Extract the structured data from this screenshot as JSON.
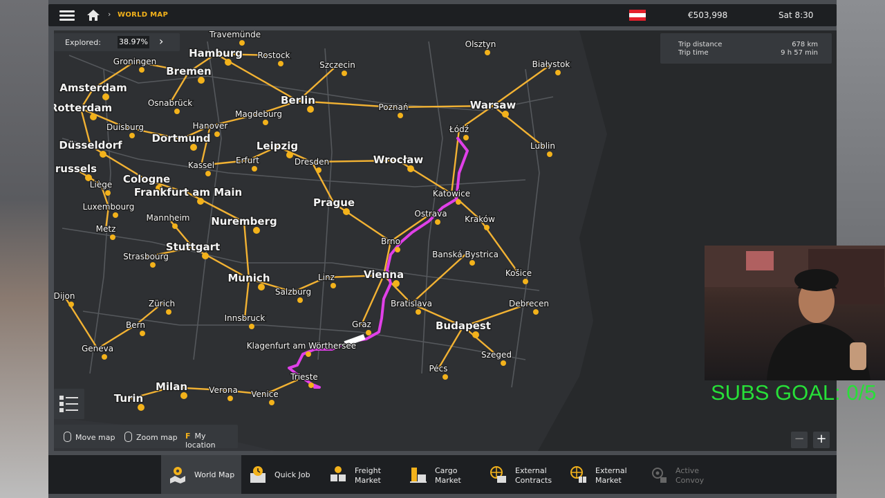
{
  "header": {
    "breadcrumb": "WORLD MAP",
    "money": "€503,998",
    "time": "Sat 8:30",
    "flag_colors": [
      "#e4202c",
      "#ffffff",
      "#e4202c"
    ]
  },
  "explored": {
    "label": "Explored:",
    "value": "38.97%"
  },
  "trip": {
    "distance_label": "Trip distance",
    "distance_value": "678 km",
    "time_label": "Trip time",
    "time_value": "9 h 57 min"
  },
  "hints": {
    "move": "Move map",
    "zoom": "Zoom map",
    "location_key": "F",
    "location": "My location"
  },
  "zoom": {
    "minus": "−",
    "plus": "+"
  },
  "tabs": [
    {
      "line1": "World Map",
      "line2": ""
    },
    {
      "line1": "Quick Job",
      "line2": ""
    },
    {
      "line1": "Freight",
      "line2": "Market"
    },
    {
      "line1": "Cargo",
      "line2": "Market"
    },
    {
      "line1": "External",
      "line2": "Contracts"
    },
    {
      "line1": "External",
      "line2": "Market"
    },
    {
      "line1": "Active",
      "line2": "Convoy"
    }
  ],
  "overlay": {
    "subs_goal": "SUBS GOAL: 0/5"
  },
  "colors": {
    "route": "#e040e8",
    "road": "#f2b233",
    "city": "#f3b21b"
  },
  "cities": [
    {
      "name": "Travemünde",
      "big": false
    },
    {
      "name": "Hamburg",
      "big": true
    },
    {
      "name": "Rostock",
      "big": false
    },
    {
      "name": "Olsztyn",
      "big": false
    },
    {
      "name": "Groningen",
      "big": false
    },
    {
      "name": "Bremen",
      "big": true
    },
    {
      "name": "Szczecin",
      "big": false
    },
    {
      "name": "Białystok",
      "big": false
    },
    {
      "name": "Amsterdam",
      "big": true
    },
    {
      "name": "Berlin",
      "big": true
    },
    {
      "name": "Poznań",
      "big": false
    },
    {
      "name": "Warsaw",
      "big": true
    },
    {
      "name": "Rotterdam",
      "big": true
    },
    {
      "name": "Osnabrück",
      "big": false
    },
    {
      "name": "Magdeburg",
      "big": false
    },
    {
      "name": "Łódź",
      "big": false
    },
    {
      "name": "Hanover",
      "big": false
    },
    {
      "name": "Duisburg",
      "big": false
    },
    {
      "name": "Dortmund",
      "big": true
    },
    {
      "name": "Lublin",
      "big": false
    },
    {
      "name": "Düsseldorf",
      "big": true
    },
    {
      "name": "Leipzig",
      "big": true
    },
    {
      "name": "Wrocław",
      "big": true
    },
    {
      "name": "Erfurt",
      "big": false
    },
    {
      "name": "Kassel",
      "big": false
    },
    {
      "name": "Dresden",
      "big": false
    },
    {
      "name": "russels",
      "big": true
    },
    {
      "name": "Cologne",
      "big": true
    },
    {
      "name": "Liège",
      "big": false
    },
    {
      "name": "Katowice",
      "big": false
    },
    {
      "name": "Frankfurt am Main",
      "big": true
    },
    {
      "name": "Prague",
      "big": true
    },
    {
      "name": "Luxembourg",
      "big": false
    },
    {
      "name": "Ostrava",
      "big": false
    },
    {
      "name": "Mannheim",
      "big": false
    },
    {
      "name": "Kraków",
      "big": false
    },
    {
      "name": "Nuremberg",
      "big": true
    },
    {
      "name": "Metz",
      "big": false
    },
    {
      "name": "Brno",
      "big": false
    },
    {
      "name": "Stuttgart",
      "big": true
    },
    {
      "name": "Banská Bystrica",
      "big": false
    },
    {
      "name": "Strasbourg",
      "big": false
    },
    {
      "name": "Vienna",
      "big": true
    },
    {
      "name": "Košice",
      "big": false
    },
    {
      "name": "Munich",
      "big": true
    },
    {
      "name": "Linz",
      "big": false
    },
    {
      "name": "Salzburg",
      "big": false
    },
    {
      "name": "Dijon",
      "big": false
    },
    {
      "name": "Bratislava",
      "big": false
    },
    {
      "name": "Debrecen",
      "big": false
    },
    {
      "name": "Zürich",
      "big": false
    },
    {
      "name": "Innsbruck",
      "big": false
    },
    {
      "name": "Graz",
      "big": false
    },
    {
      "name": "Budapest",
      "big": true
    },
    {
      "name": "Bern",
      "big": false
    },
    {
      "name": "Klagenfurt am Wörthersee",
      "big": false
    },
    {
      "name": "Geneva",
      "big": false
    },
    {
      "name": "Szeged",
      "big": false
    },
    {
      "name": "Pécs",
      "big": false
    },
    {
      "name": "Trieste",
      "big": false
    },
    {
      "name": "Milan",
      "big": true
    },
    {
      "name": "Verona",
      "big": false
    },
    {
      "name": "Venice",
      "big": false
    },
    {
      "name": "Turin",
      "big": true
    }
  ]
}
